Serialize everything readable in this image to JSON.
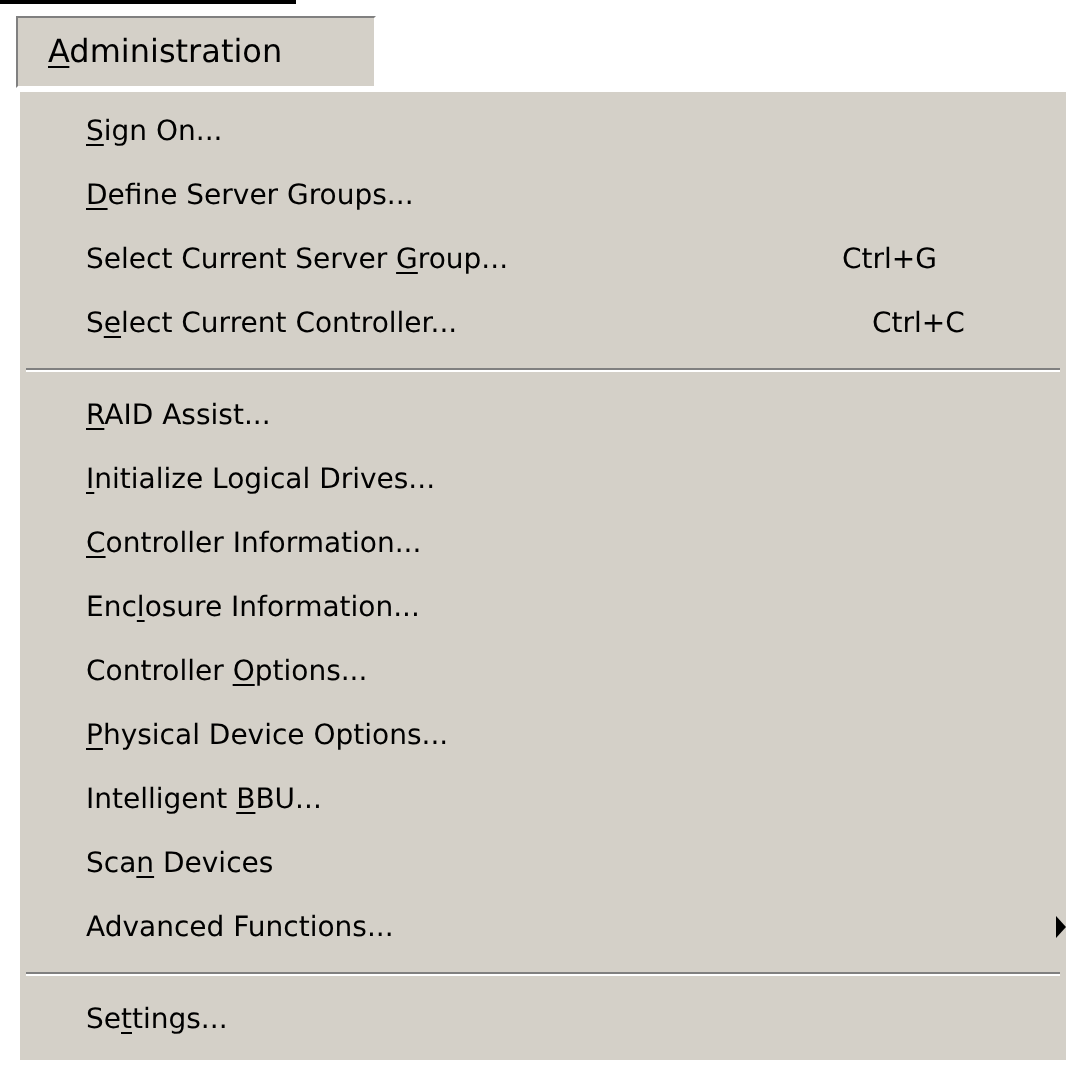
{
  "menu_bar": {
    "title": {
      "key": "A",
      "post": "dministration"
    },
    "open": true
  },
  "menu_groups": [
    {
      "items": [
        {
          "label": {
            "key": "S",
            "post": "ign On..."
          }
        },
        {
          "label": {
            "key": "D",
            "post": "efine Server Groups..."
          }
        },
        {
          "label": {
            "pre": "Select Current Server ",
            "key": "G",
            "post": "roup..."
          },
          "shortcut": "Ctrl+G"
        },
        {
          "label": {
            "pre": "S",
            "key": "e",
            "post": "lect Current Controller..."
          },
          "shortcut": "Ctrl+C"
        }
      ]
    },
    {
      "items": [
        {
          "label": {
            "key": "R",
            "post": "AID Assist..."
          }
        },
        {
          "label": {
            "key": "I",
            "post": "nitialize Logical Drives..."
          }
        },
        {
          "label": {
            "key": "C",
            "post": "ontroller Information..."
          }
        },
        {
          "label": {
            "pre": "Enc",
            "key": "l",
            "post": "osure Information..."
          }
        },
        {
          "label": {
            "pre": "Controller ",
            "key": "O",
            "post": "ptions..."
          }
        },
        {
          "label": {
            "key": "P",
            "post": "hysical Device Options..."
          }
        },
        {
          "label": {
            "pre": "Intelligent ",
            "key": "B",
            "post": "BU..."
          }
        },
        {
          "label": {
            "pre": "Sca",
            "key": "n",
            "post": " Devices"
          }
        },
        {
          "label": {
            "post": "Advanced Functions..."
          },
          "submenu": true
        }
      ]
    },
    {
      "items": [
        {
          "label": {
            "pre": "Se",
            "key": "t",
            "post": "tings..."
          }
        }
      ]
    }
  ]
}
